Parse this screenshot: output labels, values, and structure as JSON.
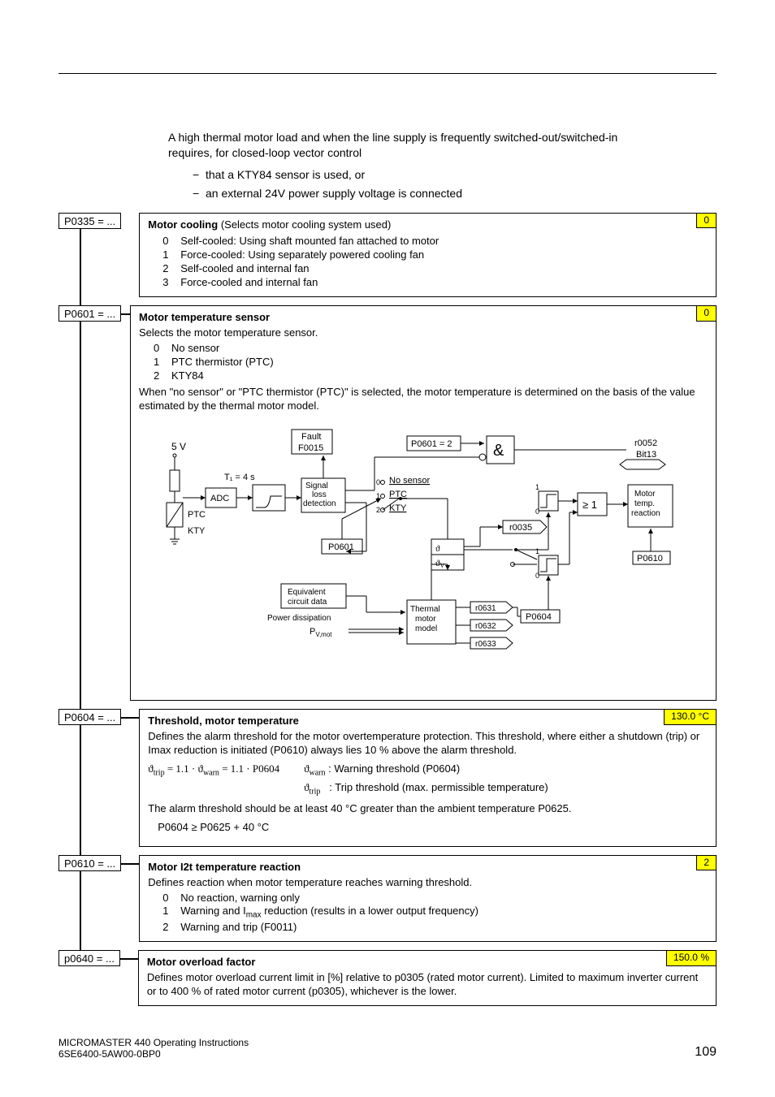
{
  "intro": {
    "para": "A high thermal motor load and when the line supply is frequently switched-out/switched-in requires, for closed-loop vector control",
    "bullet1": "that a KTY84 sensor is used, or",
    "bullet2": "an external 24V power supply voltage is connected"
  },
  "params": {
    "p0335": {
      "label": "P0335 = ...",
      "title": "Motor cooling",
      "subtitle": "(Selects motor cooling system used)",
      "default": "0",
      "options": [
        {
          "n": "0",
          "t": "Self-cooled: Using shaft mounted fan attached to motor"
        },
        {
          "n": "1",
          "t": "Force-cooled: Using separately powered cooling fan"
        },
        {
          "n": "2",
          "t": "Self-cooled and internal fan"
        },
        {
          "n": "3",
          "t": "Force-cooled and internal fan"
        }
      ]
    },
    "p0601": {
      "label": "P0601 = ...",
      "title": "Motor temperature sensor",
      "default": "0",
      "lead": "Selects the motor temperature sensor.",
      "options": [
        {
          "n": "0",
          "t": "No sensor"
        },
        {
          "n": "1",
          "t": "PTC thermistor (PTC)"
        },
        {
          "n": "2",
          "t": "KTY84"
        }
      ],
      "tail": "When \"no sensor\" or \"PTC thermistor (PTC)\" is selected, the motor temperature is determined on the basis of the value estimated by the thermal motor model."
    },
    "p0604": {
      "label": "P0604 = ...",
      "title": "Threshold, motor temperature",
      "default": "130.0 °C",
      "para": "Defines the alarm threshold for the motor overtemperature protection. This threshold, where either a shutdown (trip) or Imax reduction is initiated (P0610) always lies 10 % above the alarm threshold.",
      "formula_left": "ϑtrip = 1.1 · ϑwarn = 1.1 · P0604",
      "formula_r1_lbl": "ϑwarn",
      "formula_r1_txt": ": Warning threshold (P0604)",
      "formula_r2_lbl": "ϑtrip",
      "formula_r2_txt": ": Trip threshold (max. permissible temperature)",
      "para2": "The alarm threshold should be at least 40 °C greater than the ambient temperature P0625.",
      "formula2": "P0604 ≥ P0625 + 40 °C"
    },
    "p0610": {
      "label": "P0610 = ...",
      "title": "Motor I2t temperature reaction",
      "default": "2",
      "lead": "Defines reaction when motor temperature reaches warning threshold.",
      "options": [
        {
          "n": "0",
          "t": "No reaction, warning only"
        },
        {
          "n": "1",
          "t": "Warning and Imax reduction (results in a lower output frequency)"
        },
        {
          "n": "2",
          "t": "Warning and trip (F0011)"
        }
      ]
    },
    "p0640": {
      "label": "p0640 = ...",
      "title": "Motor overload factor",
      "default": "150.0 %",
      "para": "Defines motor overload current limit in [%] relative to p0305 (rated motor current). Limited to maximum inverter current or to 400 % of rated motor current (p0305), whichever is the lower."
    }
  },
  "diagram": {
    "fault": "Fault",
    "f0015": "F0015",
    "five_v": "5 V",
    "t1": "T₁ = 4 s",
    "adc": "ADC",
    "ptc": "PTC",
    "kty": "KTY",
    "signal_loss": "Signal\nloss\ndetection",
    "p0601": "P0601",
    "no_sensor": "No sensor",
    "ptc_opt": "PTC",
    "kty_opt": "KTY",
    "p0601_2": "P0601 = 2",
    "r0052": "r0052",
    "bit13": "Bit13",
    "amp": "&",
    "ge1": "≥ 1",
    "motor_temp_reaction": "Motor\ntemp.\nreaction",
    "p0610": "P0610",
    "r0035": "r0035",
    "equiv": "Equivalent\ncircuit data",
    "power_diss": "Power dissipation",
    "pvmot": "PV,mot",
    "thermal": "Thermal\nmotor\nmodel",
    "r0631": "r0631",
    "r0632": "r0632",
    "r0633": "r0633",
    "p0604": "P0604",
    "theta": "ϑ",
    "thetav": "ϑV"
  },
  "footer": {
    "line1": "MICROMASTER 440    Operating Instructions",
    "line2": "6SE6400-5AW00-0BP0",
    "page": "109"
  },
  "chart_data": {
    "type": "diagram",
    "title": "Motor temperature sensing / thermal motor model block diagram",
    "blocks": [
      {
        "id": "adc",
        "label": "ADC",
        "inputs": [
          "5V",
          "PTC",
          "KTY"
        ],
        "time_constant": "T1 = 4 s"
      },
      {
        "id": "signal_loss",
        "label": "Signal loss detection",
        "outputs_to": [
          "fault_F0015",
          "sensor_switch"
        ]
      },
      {
        "id": "sensor_switch",
        "label": "P0601",
        "options": {
          "0": "No sensor",
          "1": "PTC",
          "2": "KTY"
        }
      },
      {
        "id": "and_gate",
        "label": "&",
        "inputs": [
          "signal_loss",
          "P0601=2"
        ],
        "output_to": "r0052 Bit13"
      },
      {
        "id": "threshold_compare",
        "inputs": [
          "ϑ",
          "ϑV"
        ],
        "output_to": "ge1_gate",
        "source": "r0035"
      },
      {
        "id": "ge1_gate",
        "label": ">=1",
        "output_to": "motor_temp_reaction"
      },
      {
        "id": "motor_temp_reaction",
        "label": "Motor temp. reaction",
        "param": "P0610"
      },
      {
        "id": "thermal_model",
        "label": "Thermal motor model",
        "inputs": [
          "Equivalent circuit data",
          "Power dissipation PV,mot"
        ],
        "outputs": [
          "r0631",
          "r0632",
          "r0633"
        ]
      },
      {
        "id": "p0604",
        "label": "P0604",
        "connects_to": "ge1_gate"
      }
    ],
    "fault": "F0015",
    "status_bit": "r0052 Bit13"
  }
}
